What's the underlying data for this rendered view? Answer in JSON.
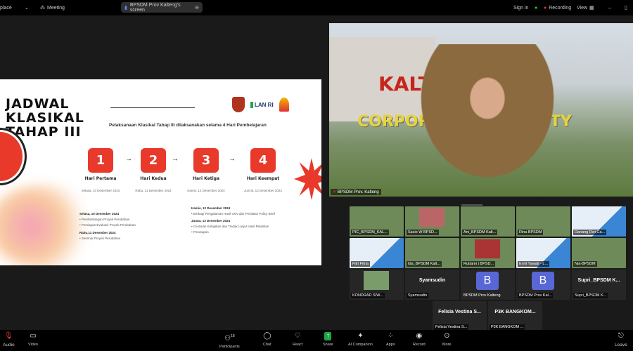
{
  "topbar": {
    "app_label": "place",
    "meeting_label": "Meeting",
    "screen_share_label": "BPSDM Prov Kalteng's screen",
    "sign_in": "Sign in",
    "recording": "Recording",
    "view": "View"
  },
  "slide": {
    "title_lines": [
      "JADWAL",
      "KLASIKAL",
      "TAHAP III"
    ],
    "logo_text": "LAN RI",
    "subtitle": "Pelaksanaan Klasikal Tahap III dilaksanakan selama 4 Hari Pembelajaran",
    "steps": [
      {
        "num": "1",
        "day": "Hari Pertama",
        "date": "Selasa, 10 Desember 2024"
      },
      {
        "num": "2",
        "day": "Hari Kedua",
        "date": "Rabu, 11 Desember 2024"
      },
      {
        "num": "3",
        "day": "Hari Ketiga",
        "date": "Kamis, 12 Desember 2024"
      },
      {
        "num": "4",
        "day": "Hari Keempat",
        "date": "Jum'at, 13 Desember 2024"
      }
    ],
    "schedule_left": {
      "h1": "Selasa, 10 Desember 2024",
      "i1": "Pembimbingan Proyek Perubahan",
      "i2": "Persiapan Evaluasi Proyek Perubahan",
      "h2": "Rabu,11 Desember 2024",
      "i3": "Seminar Proyek Perubahan"
    },
    "schedule_right": {
      "h1": "Kamis, 12 Desember 2024",
      "i1": "Berbagi Pengalaman Hasil VKN dan Penilaian Policy Brief",
      "h2": "Jumat, 13 Desember 2024",
      "i2": "Ceramah Kebijakan dan Tindak Lanjut Hasil Pelatihan",
      "i3": "Penutupan"
    }
  },
  "speaker": {
    "name": "BPSDM Prov. Kalteng",
    "sign_top": "KALTENG",
    "sign_bottom": "CORPORATE UNIVERSITY"
  },
  "gallery": {
    "row1": [
      "PIC_BPSDM_KAL...",
      "Sacie W BPSD...",
      "Ani_BPSDM Kalt...",
      "Rina BPSDM",
      "Danang Dwi Ca..."
    ],
    "row2": [
      "Fitri Fitria",
      "Ida_BPSDM Kalt...",
      "Ruttami | BPSD...",
      "Ernil Yawati - L...",
      "Nia-BPSDM"
    ],
    "row3": [
      {
        "name": "KONDRAD SIW...",
        "big": ""
      },
      {
        "name": "Syamsudin",
        "big": "Syamsudin"
      },
      {
        "name": "BPSDM Prov Kalteng",
        "avatar": "B"
      },
      {
        "name": "BPSDM Prov Kal...",
        "avatar": "B"
      },
      {
        "name": "Supri_BPSDM K...",
        "big": "Supri_BPSDM K..."
      }
    ],
    "row4": [
      {
        "name": "Felisia Vestina S...",
        "big": "Felisia Vestina S..."
      },
      {
        "name": "P3K BANGKOM ...",
        "big": "P3K BANGKOM..."
      }
    ]
  },
  "toolbar": {
    "audio": "Audio",
    "video": "Video",
    "participants": "Participants",
    "participants_count": "18",
    "chat": "Chat",
    "react": "React",
    "share": "Share",
    "ai": "AI Companion",
    "apps": "Apps",
    "record": "Record",
    "more": "More",
    "leave": "Leave"
  }
}
